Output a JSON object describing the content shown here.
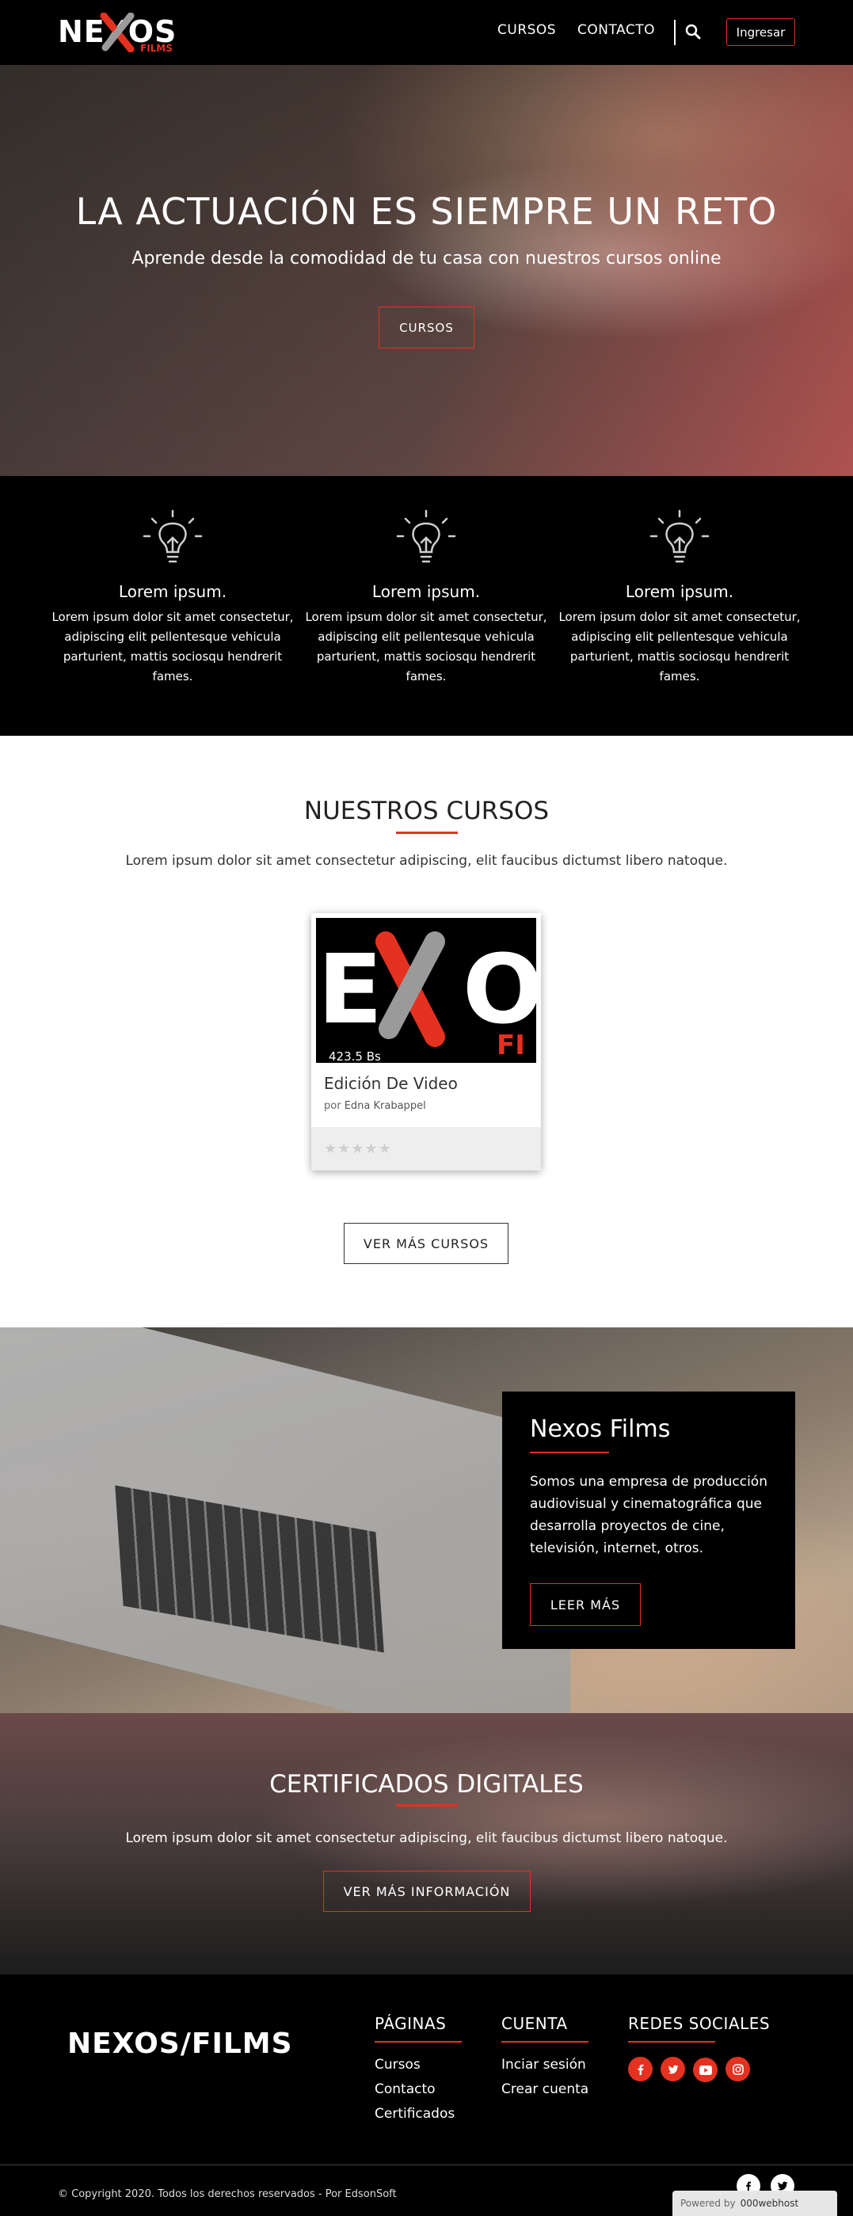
{
  "header": {
    "logo_text": "NEXOS",
    "logo_sub": "FILMS",
    "nav": [
      "CURSOS",
      "CONTACTO"
    ],
    "login_label": "Ingresar"
  },
  "hero": {
    "title": "LA ACTUACIÓN ES SIEMPRE UN RETO",
    "subtitle": "Aprende desde la comodidad de tu casa con nuestros cursos online",
    "button_label": "CURSOS"
  },
  "features": [
    {
      "title": "Lorem ipsum.",
      "text": "Lorem ipsum dolor sit amet consectetur, adipiscing elit pellentesque vehicula parturient, mattis sociosqu hendrerit fames.",
      "icon": "lightbulb-icon"
    },
    {
      "title": "Lorem ipsum.",
      "text": "Lorem ipsum dolor sit amet consectetur, adipiscing elit pellentesque vehicula parturient, mattis sociosqu hendrerit fames.",
      "icon": "lightbulb-icon"
    },
    {
      "title": "Lorem ipsum.",
      "text": "Lorem ipsum dolor sit amet consectetur, adipiscing elit pellentesque vehicula parturient, mattis sociosqu hendrerit fames.",
      "icon": "lightbulb-icon"
    }
  ],
  "courses": {
    "title": "NUESTROS CURSOS",
    "description": "Lorem ipsum dolor sit amet consectetur adipiscing, elit faucibus dictumst libero natoque.",
    "card": {
      "price": "423.5 Bs",
      "title": "Edición De Video",
      "author_prefix": "por",
      "author": "Edna Krabappel",
      "rating": 0,
      "max_rating": 5
    },
    "more_button": "VER MÁS CURSOS"
  },
  "about": {
    "title": "Nexos Films",
    "text": "Somos una empresa de producción audiovisual y cinematográfica que desarrolla proyectos de cine, televisión, internet, otros.",
    "button": "LEER MÁS"
  },
  "certificates": {
    "title": "CERTIFICADOS DIGITALES",
    "description": "Lorem ipsum dolor sit amet consectetur adipiscing, elit faucibus dictumst libero natoque.",
    "button": "VER MÁS INFORMACIÓN"
  },
  "footer": {
    "logo_text": "NEXOS/FILMS",
    "pages_title": "PÁGINAS",
    "pages": [
      "Cursos",
      "Contacto",
      "Certificados"
    ],
    "account_title": "CUENTA",
    "account": [
      "Inciar sesión",
      "Crear cuenta"
    ],
    "social_title": "REDES SOCIALES",
    "social_icons": [
      "facebook-icon",
      "twitter-icon",
      "youtube-icon",
      "instagram-icon"
    ],
    "copyright": "© Copyright 2020. Todos los derechos reservados - Por EdsonSoft",
    "powered_by": "Powered by",
    "host": "000webhost"
  },
  "colors": {
    "accent": "#e5311f",
    "dark": "#000000"
  }
}
